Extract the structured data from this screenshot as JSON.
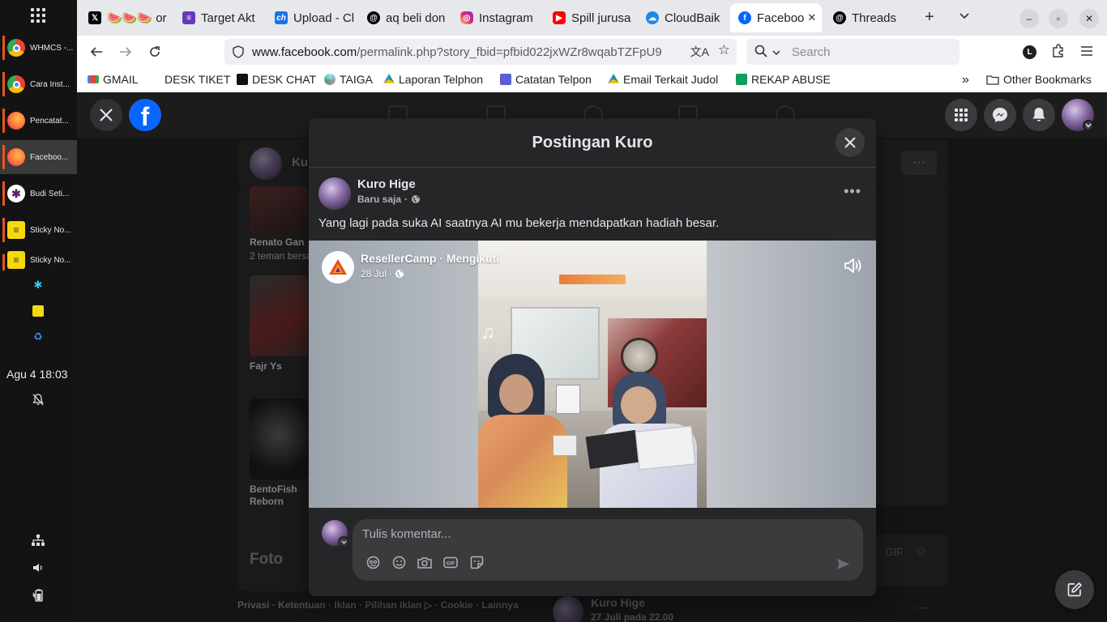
{
  "taskbar": {
    "items": [
      {
        "label": "WHMCS -...",
        "color": "#4285f4"
      },
      {
        "label": "Cara Inst...",
        "color": "#4285f4"
      },
      {
        "label": "Pencatat...",
        "color": "#ff7139"
      },
      {
        "label": "Faceboo...",
        "color": "#ff7139"
      },
      {
        "label": "Budi Seti...",
        "color": "#611f69"
      },
      {
        "label": "Sticky No...",
        "color": "#f5d90a"
      },
      {
        "label": "Sticky No...",
        "color": "#f5d90a"
      }
    ],
    "clock": "Agu 4  18:03"
  },
  "browser": {
    "tabs": [
      {
        "label": "🍉🍉🍉 or",
        "icon": "x-icon"
      },
      {
        "label": "Target Akt",
        "icon": "form-icon"
      },
      {
        "label": "Upload - Cl",
        "icon": "ch-icon"
      },
      {
        "label": "aq beli don",
        "icon": "threads-icon"
      },
      {
        "label": "Instagram",
        "icon": "instagram-icon"
      },
      {
        "label": "Spill jurusa",
        "icon": "youtube-icon"
      },
      {
        "label": "CloudBaik",
        "icon": "cloud-icon"
      },
      {
        "label": "Faceboo",
        "icon": "facebook-icon"
      },
      {
        "label": "Threads",
        "icon": "threads-icon"
      }
    ],
    "url_host": "www.facebook.com",
    "url_path": "/permalink.php?story_fbid=pfbid022jxWZr8wqabTZFpU9",
    "search_placeholder": "Search",
    "profile_initial": "L",
    "bookmarks": [
      {
        "label": "GMAIL",
        "icon": "gmail-icon"
      },
      {
        "label": "DESK TIKET",
        "icon": "none"
      },
      {
        "label": "DESK CHAT",
        "icon": "desk-chat-icon"
      },
      {
        "label": "TAIGA",
        "icon": "taiga-icon"
      },
      {
        "label": "Laporan Telphon",
        "icon": "drive-icon"
      },
      {
        "label": "Catatan Telpon",
        "icon": "notes-icon"
      },
      {
        "label": "Email Terkait Judol",
        "icon": "drive-icon"
      },
      {
        "label": "REKAP ABUSE",
        "icon": "sheets-icon"
      }
    ],
    "other_bookmarks": "Other Bookmarks"
  },
  "background": {
    "card_name_prefix": "Ku",
    "friend1_name": "Renato Gan",
    "friend1_sub": "2 teman bersa",
    "friend2_name": "Fajr Ys",
    "friend3_name": "BentoFish Reborn",
    "foto_heading": "Foto",
    "footer_links": "Privasi · Ketentuan · Iklan · Pilihan Iklan ▷ · Cookie · Lainnya",
    "next_post_author": "Kuro Hige",
    "next_post_date": "27 Juli pada 22.00"
  },
  "modal": {
    "title": "Postingan Kuro",
    "author": "Kuro Hige",
    "meta": "Baru saja",
    "text": "Yang lagi pada suka AI saatnya AI mu bekerja mendapatkan hadiah besar.",
    "shared_page": "ResellerCamp · Mengikuti",
    "shared_date": "28 Jul",
    "comment_placeholder": "Tulis komentar..."
  },
  "colors": {
    "facebook_blue": "#0866ff",
    "modal_bg": "#252627",
    "page_bg": "#141415"
  }
}
